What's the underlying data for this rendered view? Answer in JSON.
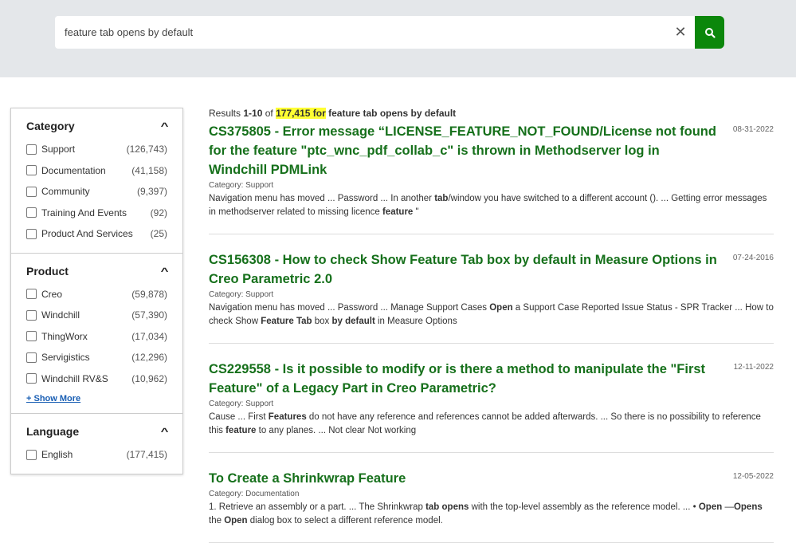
{
  "search": {
    "value": "feature tab opens by default"
  },
  "facets": [
    {
      "title": "Category",
      "items": [
        {
          "label": "Support",
          "count": "(126,743)"
        },
        {
          "label": "Documentation",
          "count": "(41,158)"
        },
        {
          "label": "Community",
          "count": "(9,397)"
        },
        {
          "label": "Training And Events",
          "count": "(92)"
        },
        {
          "label": "Product And Services",
          "count": "(25)"
        }
      ]
    },
    {
      "title": "Product",
      "items": [
        {
          "label": "Creo",
          "count": "(59,878)"
        },
        {
          "label": "Windchill",
          "count": "(57,390)"
        },
        {
          "label": "ThingWorx",
          "count": "(17,034)"
        },
        {
          "label": "Servigistics",
          "count": "(12,296)"
        },
        {
          "label": "Windchill RV&S",
          "count": "(10,962)"
        }
      ],
      "show_more": "+ Show More"
    },
    {
      "title": "Language",
      "items": [
        {
          "label": "English",
          "count": "(177,415)"
        }
      ]
    }
  ],
  "summary": {
    "prefix": "Results ",
    "range": "1-10",
    "of": " of ",
    "total": "177,415 for",
    "query": " feature tab opens by default"
  },
  "results": [
    {
      "title": "CS375805 - Error message “LICENSE_FEATURE_NOT_FOUND/License not found for the feature \"ptc_wnc_pdf_collab_c\" is thrown in Methodserver log in Windchill PDMLink",
      "date": "08-31-2022",
      "category": "Category: Support",
      "snippet": "Navigation menu has moved ... Password ... In another <b>tab</b>/window you have switched to a different account (). ... Getting error messages in methodserver related to missing licence <b>feature</b> \""
    },
    {
      "title": "CS156308 - How to check Show Feature Tab box by default in Measure Options in Creo Parametric 2.0",
      "date": "07-24-2016",
      "category": "Category: Support",
      "snippet": "Navigation menu has moved ... Password ... Manage Support Cases <b>Open</b> a Support Case Reported Issue Status - SPR Tracker ... How to check Show <b>Feature Tab</b> box <b>by default</b> in Measure Options"
    },
    {
      "title": "CS229558 - Is it possible to modify or is there a method to manipulate the \"First Feature\" of a Legacy Part in Creo Parametric?",
      "date": "12-11-2022",
      "category": "Category: Support",
      "snippet": "Cause ... First <b>Features</b> do not have any reference and references cannot be added afterwards. ... So there is no possibility to reference this <b>feature</b> to any planes. ... Not clear Not working"
    },
    {
      "title": "To Create a Shrinkwrap Feature",
      "date": "12-05-2022",
      "category": "Category: Documentation",
      "snippet": "1. Retrieve an assembly or a part. ... The Shrinkwrap <b>tab opens</b> with the top-level assembly as the reference model. ... • <b>Open</b> —<b>Opens</b> the <b>Open</b> dialog box to select a different reference model."
    }
  ]
}
